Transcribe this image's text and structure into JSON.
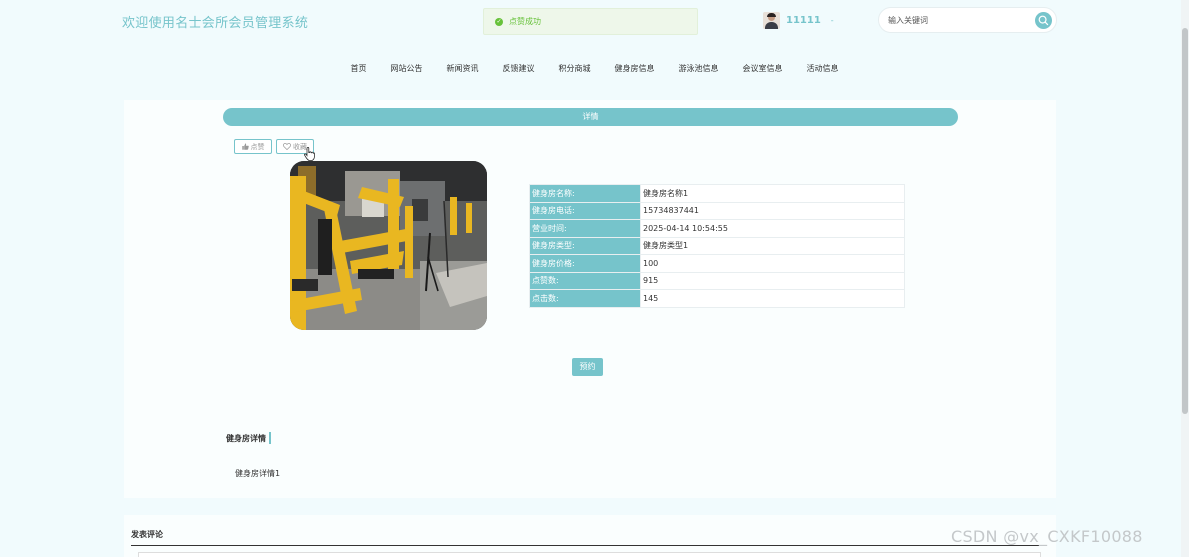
{
  "header": {
    "title": "欢迎使用名士会所会员管理系统",
    "toast": "点赞成功",
    "username": "11111",
    "caret": "-",
    "search_placeholder": "输入关键词"
  },
  "nav": [
    "首页",
    "网站公告",
    "新闻资讯",
    "反馈建议",
    "积分商城",
    "健身房信息",
    "游泳池信息",
    "会议室信息",
    "活动信息"
  ],
  "detail": {
    "bar_title": "详情",
    "like_label": "点赞",
    "fav_label": "收藏",
    "fields": [
      {
        "label": "健身房名称:",
        "value": "健身房名称1"
      },
      {
        "label": "健身房电话:",
        "value": "15734837441"
      },
      {
        "label": "营业时间:",
        "value": "2025-04-14 10:54:55"
      },
      {
        "label": "健身房类型:",
        "value": "健身房类型1"
      },
      {
        "label": "健身房价格:",
        "value": "100"
      },
      {
        "label": "点赞数:",
        "value": "915"
      },
      {
        "label": "点击数:",
        "value": "145"
      }
    ],
    "book_label": "预约",
    "section_title": "健身房详情",
    "section_content": "健身房详情1"
  },
  "comments": {
    "title": "发表评论"
  },
  "watermark": "CSDN @vx_CXKF10088",
  "colors": {
    "accent": "#76c4cb",
    "success": "#67c23a",
    "background": "#f1fbfd"
  }
}
